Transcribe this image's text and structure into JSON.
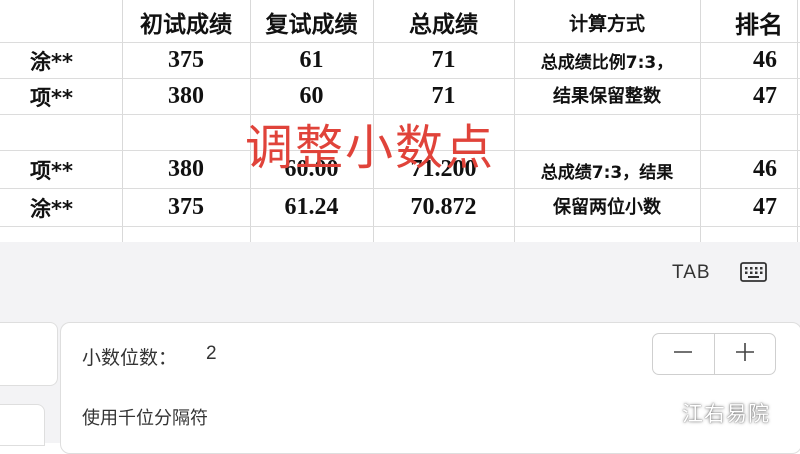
{
  "sheet": {
    "headers": {
      "initial": "初试成绩",
      "retest": "复试成绩",
      "total": "总成绩",
      "method": "计算方式",
      "rank": "排名"
    },
    "rows": [
      {
        "name": "涂**",
        "initial": "375",
        "retest": "61",
        "total": "71",
        "rank": "46"
      },
      {
        "name": "项**",
        "initial": "380",
        "retest": "60",
        "total": "71",
        "rank": "47"
      },
      {
        "name": "项**",
        "initial": "380",
        "retest": "60.00",
        "total": "71.200",
        "rank": "46"
      },
      {
        "name": "涂**",
        "initial": "375",
        "retest": "61.24",
        "total": "70.872",
        "rank": "47"
      }
    ],
    "notes": {
      "first_line1": "总成绩比例7:3，",
      "first_line2": "结果保留整数",
      "second_line1": "总成绩7:3，结果",
      "second_line2": "保留两位小数"
    },
    "overlay_text": "调整小数点",
    "overlay_color": "#e0433a",
    "grid_color": "#d9d9d9"
  },
  "toolbar": {
    "tab_label": "TAB",
    "keyboard_icon": "keyboard-icon"
  },
  "format_panel": {
    "decimal_label": "小数位数：",
    "decimal_value": "2",
    "minus_icon": "minus-icon",
    "plus_icon": "plus-icon",
    "thousands_label": "使用千位分隔符"
  },
  "watermark": "江右易院"
}
